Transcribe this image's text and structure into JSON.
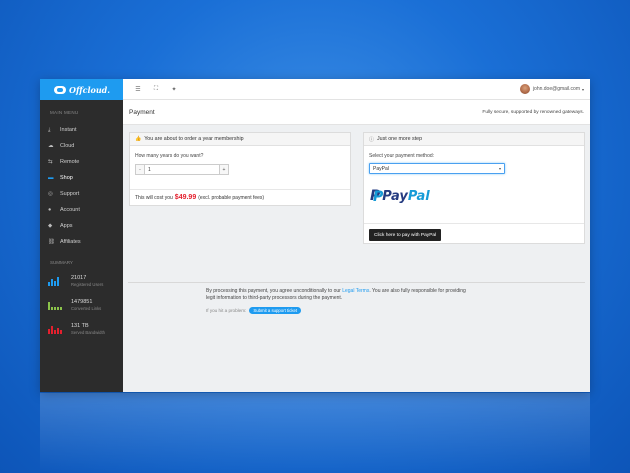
{
  "app": {
    "logo_text": "Offcloud.",
    "main_menu_label": "MAIN MENU",
    "summary_label": "SUMMARY"
  },
  "sidebar": {
    "items": [
      {
        "label": "Instant",
        "icon": "download-icon"
      },
      {
        "label": "Cloud",
        "icon": "cloud-icon"
      },
      {
        "label": "Remote",
        "icon": "remote-icon"
      },
      {
        "label": "Shop",
        "icon": "cart-icon"
      },
      {
        "label": "Support",
        "icon": "support-icon"
      },
      {
        "label": "Account",
        "icon": "user-icon"
      },
      {
        "label": "Apps",
        "icon": "apps-icon"
      },
      {
        "label": "Affiliates",
        "icon": "link-icon"
      }
    ],
    "active_index": 3,
    "stats": [
      {
        "value": "21017",
        "label": "Registered Users",
        "color": "#1e9bf0"
      },
      {
        "value": "1479851",
        "label": "Converted Links",
        "color": "#8bc34a"
      },
      {
        "value": "131 TB",
        "label": "Served Bandwidth",
        "color": "#e4202e"
      }
    ]
  },
  "topbar": {
    "user_email": "john.doe@gmail.com"
  },
  "page": {
    "title": "Payment",
    "secure_text": "Fully secure, supported by renowned gateways."
  },
  "order_panel": {
    "heading": "You are about to order a year membership",
    "question": "How many years do you want?",
    "minus": "-",
    "quantity": "1",
    "plus": "+",
    "cost_prefix": "This will cost you",
    "price": "$49.99",
    "cost_suffix": "(excl. probable payment fees)"
  },
  "payment_panel": {
    "heading": "Just one more step",
    "select_label": "Select your payment method:",
    "selected_method": "PayPal",
    "pay_button": "Click here to pay with PayPal",
    "brand_pay": "Pay",
    "brand_pal": "Pal"
  },
  "footer": {
    "terms_pre": "By processing this payment, you agree unconditionally to our",
    "terms_link": "Legal Terms",
    "terms_post": ". You are also fully responsible for providing legit information to third-party processors during the payment.",
    "problem_text": "If you hit a problem:",
    "ticket_button": "Submit a support ticket"
  }
}
